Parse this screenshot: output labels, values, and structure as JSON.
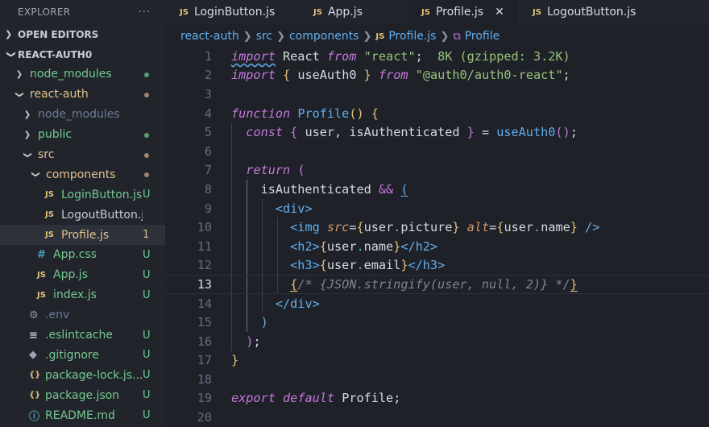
{
  "explorer": {
    "title": "EXPLORER",
    "more": "···",
    "open_editors": "OPEN EDITORS",
    "project": "REACT-AUTH0",
    "items": [
      {
        "label": "node_modules",
        "color": "#73c991",
        "badge": "",
        "dot": "#5a9e6f",
        "type": "folder",
        "state": "collapsed",
        "depth": 1
      },
      {
        "label": "react-auth",
        "color": "#e2c08d",
        "badge": "",
        "dot": "#a0856a",
        "type": "folder",
        "state": "expanded",
        "depth": 1
      },
      {
        "label": "node_modules",
        "color": "#6d7a96",
        "badge": "",
        "dot": "",
        "type": "folder",
        "state": "collapsed",
        "depth": 2
      },
      {
        "label": "public",
        "color": "#73c991",
        "badge": "",
        "dot": "#5a9e6f",
        "type": "folder",
        "state": "collapsed",
        "depth": 2
      },
      {
        "label": "src",
        "color": "#e2c08d",
        "badge": "",
        "dot": "#a0856a",
        "type": "folder",
        "state": "expanded",
        "depth": 2
      },
      {
        "label": "components",
        "color": "#e2c08d",
        "badge": "",
        "dot": "#a0856a",
        "type": "folder",
        "state": "expanded",
        "depth": 3
      },
      {
        "label": "LoginButton.js",
        "color": "#73c991",
        "badge": "U",
        "dot": "",
        "type": "js",
        "depth": 4
      },
      {
        "label": "LogoutButton.js",
        "color": "#c8ccd4",
        "badge": "",
        "dot": "",
        "type": "js",
        "depth": 4
      },
      {
        "label": "Profile.js",
        "color": "#e2c08d",
        "badge": "1",
        "dot": "",
        "type": "js",
        "depth": 4,
        "active": true
      },
      {
        "label": "App.css",
        "color": "#73c991",
        "badge": "U",
        "dot": "",
        "type": "css",
        "depth": 3
      },
      {
        "label": "App.js",
        "color": "#73c991",
        "badge": "U",
        "dot": "",
        "type": "js",
        "depth": 3
      },
      {
        "label": "index.js",
        "color": "#73c991",
        "badge": "U",
        "dot": "",
        "type": "js",
        "depth": 3
      },
      {
        "label": ".env",
        "color": "#6d7a96",
        "badge": "",
        "dot": "",
        "type": "gear",
        "depth": 2
      },
      {
        "label": ".eslintcache",
        "color": "#73c991",
        "badge": "U",
        "dot": "",
        "type": "lines",
        "depth": 2
      },
      {
        "label": ".gitignore",
        "color": "#73c991",
        "badge": "U",
        "dot": "",
        "type": "git",
        "depth": 2
      },
      {
        "label": "package-lock.js...",
        "color": "#73c991",
        "badge": "U",
        "dot": "",
        "type": "json",
        "depth": 2
      },
      {
        "label": "package.json",
        "color": "#73c991",
        "badge": "U",
        "dot": "",
        "type": "json",
        "depth": 2
      },
      {
        "label": "README.md",
        "color": "#73c991",
        "badge": "U",
        "dot": "",
        "type": "info",
        "depth": 2
      }
    ]
  },
  "tabs": [
    {
      "label": "LoginButton.js",
      "active": false
    },
    {
      "label": "App.js",
      "active": false
    },
    {
      "label": "Profile.js",
      "active": true
    },
    {
      "label": "LogoutButton.js",
      "active": false
    }
  ],
  "breadcrumb": {
    "parts": [
      "react-auth",
      "src",
      "components"
    ],
    "file": "Profile.js",
    "symbol": "Profile"
  },
  "editor": {
    "import_size_hint": "8K (gzipped: 3.2K)",
    "line_numbers": [
      "1",
      "2",
      "3",
      "4",
      "5",
      "6",
      "7",
      "8",
      "9",
      "10",
      "11",
      "12",
      "13",
      "14",
      "15",
      "16",
      "17",
      "18",
      "19",
      "20"
    ],
    "current_line": "13"
  }
}
